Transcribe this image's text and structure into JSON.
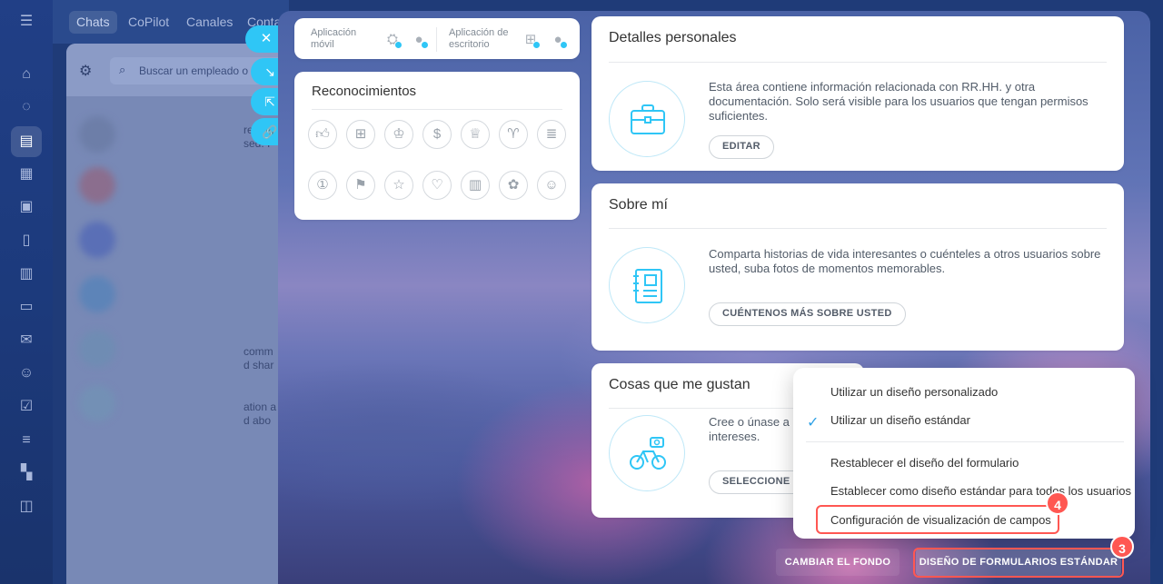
{
  "nav": {
    "tabs": [
      {
        "label": "Chats"
      },
      {
        "label": "CoPilot"
      },
      {
        "label": "Canales"
      },
      {
        "label": "Conta"
      }
    ]
  },
  "chat_panel": {
    "search_placeholder": "Buscar un empleado o",
    "fragments": [
      "re",
      "sed. I",
      "comm",
      "d shar",
      "ation a",
      "d abo"
    ]
  },
  "apps": {
    "mobile_label": "Aplicación móvil",
    "desktop_label": "Aplicación de escritorio"
  },
  "recognitions": {
    "title": "Reconocimientos"
  },
  "personal_details": {
    "title": "Detalles personales",
    "description": "Esta área contiene información relacionada con RR.HH. y otra documentación. Solo será visible para los usuarios que tengan permisos suficientes.",
    "button": "EDITAR"
  },
  "about_me": {
    "title": "Sobre mí",
    "description": "Comparta historias de vida interesantes o cuénteles a otros usuarios sobre usted, suba fotos de momentos memorables.",
    "button": "CUÉNTENOS MÁS SOBRE USTED"
  },
  "likes": {
    "title": "Cosas que me gustan",
    "description": "Cree o únase a n intereses.",
    "button": "SELECCIONE S"
  },
  "menu": {
    "items": [
      {
        "label": "Utilizar un diseño personalizado"
      },
      {
        "label": "Utilizar un diseño estándar",
        "checked": true
      },
      {
        "label": "Restablecer el diseño del formulario"
      },
      {
        "label": "Establecer como diseño estándar para todos los usuarios"
      },
      {
        "label": "Configuración de visualización de campos"
      }
    ]
  },
  "footer": {
    "change_background": "CAMBIAR EL FONDO",
    "standard_forms": "DISEÑO DE FORMULARIOS ESTÁNDAR"
  },
  "step_badges": {
    "menu_item": "4",
    "footer_button": "3"
  },
  "colors": {
    "accent": "#2fc6f6",
    "highlight": "#ff5752",
    "check": "#2fa1e6"
  }
}
